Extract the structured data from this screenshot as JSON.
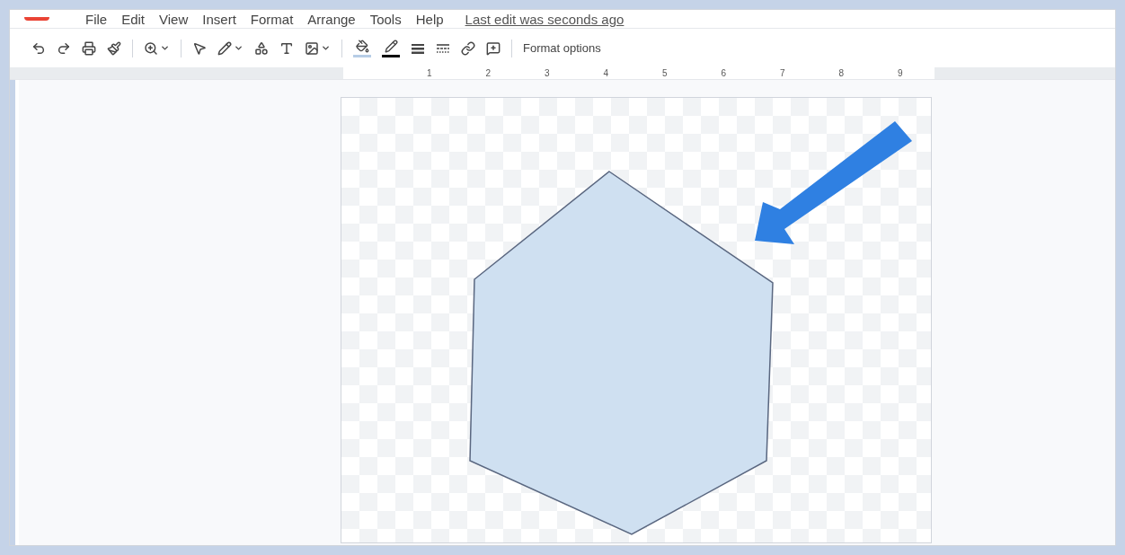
{
  "menu": [
    "File",
    "Edit",
    "View",
    "Insert",
    "Format",
    "Arrange",
    "Tools",
    "Help"
  ],
  "last_edit": "Last edit was seconds ago",
  "toolbar": {
    "format_options": "Format options"
  },
  "ruler": {
    "labels": [
      "1",
      "2",
      "3",
      "4",
      "5",
      "6",
      "7",
      "8",
      "9"
    ]
  }
}
